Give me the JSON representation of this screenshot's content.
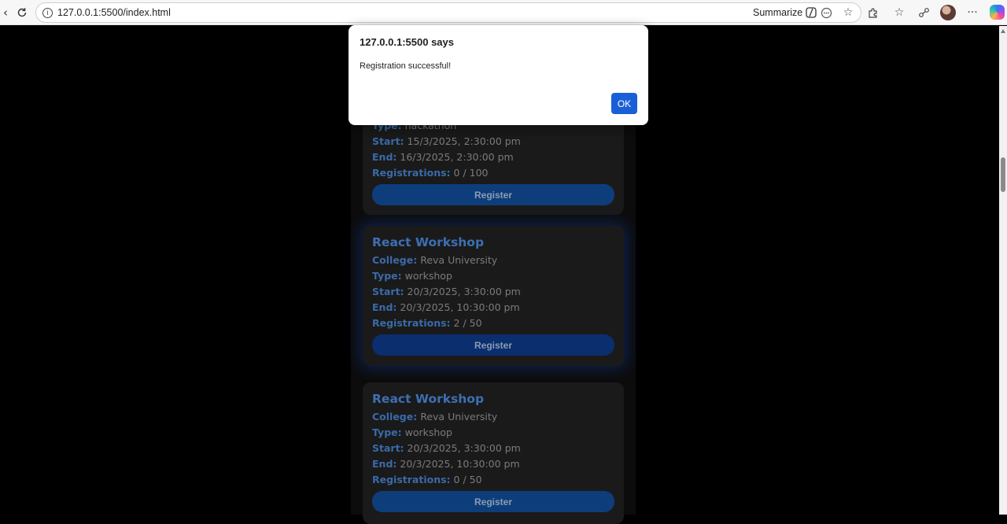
{
  "browser": {
    "url": "127.0.0.1:5500/index.html",
    "summarize_label": "Summarize"
  },
  "events": [
    {
      "title": "",
      "type_label": "Type:",
      "type": "hackathon",
      "start_label": "Start:",
      "start": "15/3/2025, 2:30:00 pm",
      "end_label": "End:",
      "end": "16/3/2025, 2:30:00 pm",
      "registrations_label": "Registrations:",
      "registrations": "0 / 100",
      "button": "Register"
    },
    {
      "title": "React Workshop",
      "college_label": "College:",
      "college": "Reva University",
      "type_label": "Type:",
      "type": "workshop",
      "start_label": "Start:",
      "start": "20/3/2025, 3:30:00 pm",
      "end_label": "End:",
      "end": "20/3/2025, 10:30:00 pm",
      "registrations_label": "Registrations:",
      "registrations": "2 / 50",
      "button": "Register"
    },
    {
      "title": "React Workshop",
      "college_label": "College:",
      "college": "Reva University",
      "type_label": "Type:",
      "type": "workshop",
      "start_label": "Start:",
      "start": "20/3/2025, 3:30:00 pm",
      "end_label": "End:",
      "end": "20/3/2025, 10:30:00 pm",
      "registrations_label": "Registrations:",
      "registrations": "0 / 50",
      "button": "Register"
    }
  ],
  "dialog": {
    "title": "127.0.0.1:5500 says",
    "message": "Registration successful!",
    "ok_label": "OK"
  },
  "colors": {
    "accent": "#1a5fd6",
    "label_blue": "#3a6aa8",
    "button_blue": "#0d3e7b"
  }
}
